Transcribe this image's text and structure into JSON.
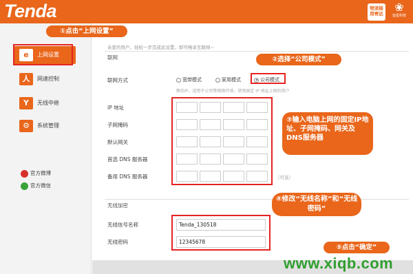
{
  "header": {
    "logo_text": "Tenda",
    "badge_text": "物流接 用寄达",
    "emblem_text": "亚星科技"
  },
  "sidebar": {
    "items": [
      {
        "label": "上网设置",
        "icon": "e"
      },
      {
        "label": "网速控制",
        "icon": "人"
      },
      {
        "label": "无线中继",
        "icon": "Y"
      },
      {
        "label": "系统管理",
        "icon": "⚙"
      }
    ],
    "social": [
      {
        "label": "官方微博",
        "color": "#d8302b"
      },
      {
        "label": "官方微信",
        "color": "#3aa337"
      }
    ]
  },
  "main": {
    "hint": "亲爱的用户，轻松一步完成此设置，即可畅享互联网~",
    "network": {
      "section_title": "联网",
      "mode_label": "联网方式",
      "modes": [
        "宽带模式",
        "家用模式",
        "公司模式"
      ],
      "mode_note": "静态IP，适用于公司等网络环境，使用固定 IP 地址上网的用户",
      "ip_label": "IP 地址",
      "mask_label": "子网掩码",
      "gateway_label": "默认网关",
      "dns1_label": "首选 DNS 服务器",
      "dns2_label": "备用 DNS 服务器",
      "optional": "（可选）"
    },
    "wireless": {
      "section_title": "无线加密",
      "ssid_label": "无线信号名称",
      "ssid_value": "Tenda_130518",
      "password_label": "无线密码",
      "password_value": "12345678"
    }
  },
  "callouts": {
    "c1": "①点击“上网设置”",
    "c2": "②选择“公司模式”",
    "c3": "③输入电脑上网的固定IP地址、子网掩码、网关及DNS服务器",
    "c4": "④修改“无线名称”和“无线密码”",
    "c5": "⑤点击“确定”"
  },
  "watermark": "www.xiqb.com"
}
